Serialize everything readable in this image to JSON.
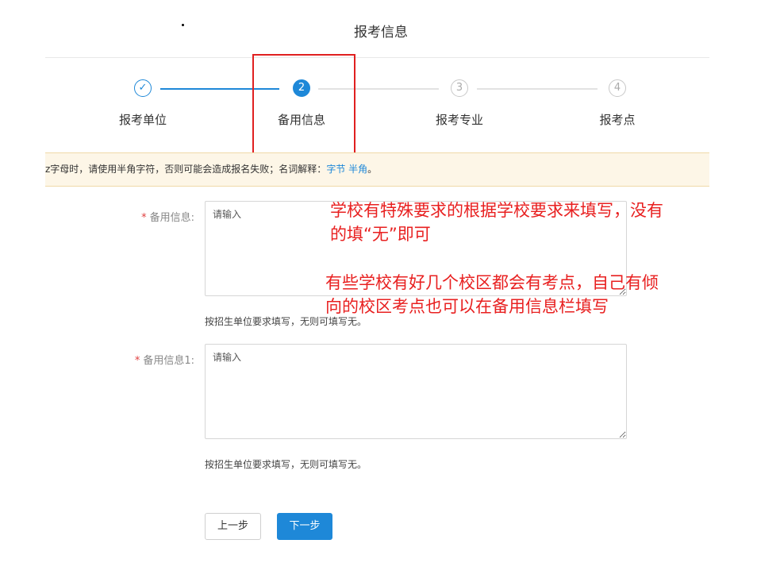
{
  "page": {
    "title": "报考信息"
  },
  "steps": [
    {
      "index": "✓",
      "label": "报考单位",
      "state": "done"
    },
    {
      "index": "2",
      "label": "备用信息",
      "state": "active"
    },
    {
      "index": "3",
      "label": "报考专业",
      "state": "pending"
    },
    {
      "index": "4",
      "label": "报考点",
      "state": "pending"
    }
  ],
  "notice": {
    "text": "z字母时，请使用半角字符，否则可能会造成报名失败；名词解释：",
    "link_1": "字节",
    "link_2": "半角",
    "suffix": "。"
  },
  "form": {
    "field_1": {
      "required_mark": "*",
      "label": "备用信息:",
      "placeholder": "请输入",
      "hint": "按招生单位要求填写，无则可填写无。"
    },
    "field_2": {
      "required_mark": "*",
      "label": "备用信息1:",
      "placeholder": "请输入",
      "hint": "按招生单位要求填写，无则可填写无。"
    }
  },
  "annotations": {
    "note_1_line_1": "学校有特殊要求的根据学校要求来填写，没有",
    "note_1_line_2": "的填“无”即可",
    "note_2_line_1": "有些学校有好几个校区都会有考点，自己有倾",
    "note_2_line_2": "向的校区考点也可以在备用信息栏填写"
  },
  "buttons": {
    "prev": "上一步",
    "next": "下一步"
  },
  "colors": {
    "accent": "#1e88d8",
    "annotation": "#e82020",
    "notice_bg": "#fdf6e7"
  }
}
